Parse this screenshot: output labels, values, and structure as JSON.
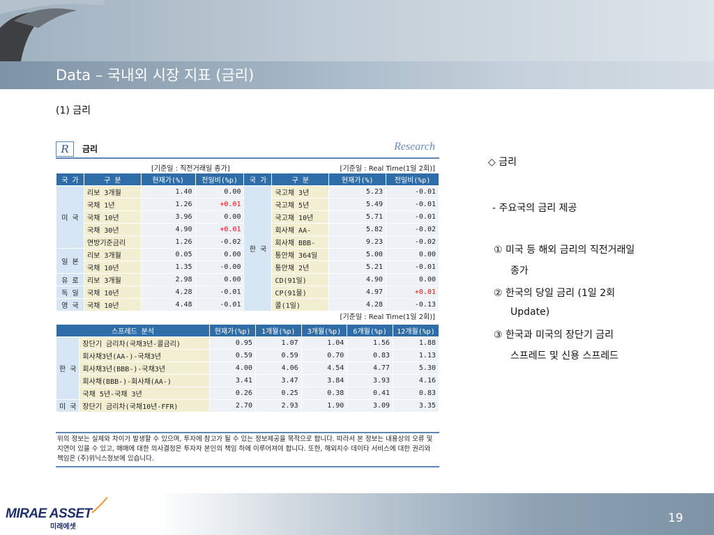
{
  "slide": {
    "title": "Data – 국내외 시장 지표 (금리)",
    "section": "(1) 금리",
    "page_number": "19"
  },
  "panel": {
    "logo_letter": "R",
    "title": "금리",
    "brand": "Research",
    "ref_left": "[기준일 : 직전거래일 종가]",
    "ref_right": "[기준일 : Real Time(1일 2회)]",
    "ref_spread": "[기준일 : Real Time(1일 2회)]",
    "headers_left": [
      "국 가",
      "구 분",
      "현재가(%)",
      "전일비(%p)"
    ],
    "headers_right": [
      "국 가",
      "구 분",
      "현재가(%)",
      "전일비(%p)"
    ],
    "left_groups": [
      {
        "country": "미 국",
        "rows": [
          {
            "name": "리보 3개월",
            "price": "1.40",
            "chg": "0.00",
            "up": false
          },
          {
            "name": "국채 1년",
            "price": "1.26",
            "chg": "+0.01",
            "up": true
          },
          {
            "name": "국채 10년",
            "price": "3.96",
            "chg": "0.00",
            "up": false
          },
          {
            "name": "국채 30년",
            "price": "4.90",
            "chg": "+0.01",
            "up": true
          },
          {
            "name": "연방기준금리",
            "price": "1.26",
            "chg": "-0.02",
            "up": false
          }
        ]
      },
      {
        "country": "일 본",
        "rows": [
          {
            "name": "리보 3개월",
            "price": "0.05",
            "chg": "0.00",
            "up": false
          },
          {
            "name": "국채 10년",
            "price": "1.35",
            "chg": "-0.00",
            "up": false
          }
        ]
      },
      {
        "country": "유 로",
        "rows": [
          {
            "name": "리보 3개월",
            "price": "2.98",
            "chg": "0.00",
            "up": false
          }
        ]
      },
      {
        "country": "독 일",
        "rows": [
          {
            "name": "국채 10년",
            "price": "4.28",
            "chg": "-0.01",
            "up": false
          }
        ]
      },
      {
        "country": "영 국",
        "rows": [
          {
            "name": "국채 10년",
            "price": "4.48",
            "chg": "-0.01",
            "up": false
          }
        ]
      }
    ],
    "right_country": "한 국",
    "right_rows": [
      {
        "name": "국고채 3년",
        "price": "5.23",
        "chg": "-0.01",
        "up": false
      },
      {
        "name": "국고채 5년",
        "price": "5.49",
        "chg": "-0.01",
        "up": false
      },
      {
        "name": "국고채 10년",
        "price": "5.71",
        "chg": "-0.01",
        "up": false
      },
      {
        "name": "회사채 AA-",
        "price": "5.82",
        "chg": "-0.02",
        "up": false
      },
      {
        "name": "회사채 BBB-",
        "price": "9.23",
        "chg": "-0.02",
        "up": false
      },
      {
        "name": "통안채 364일",
        "price": "5.00",
        "chg": "0.00",
        "up": false
      },
      {
        "name": "통안채 2년",
        "price": "5.21",
        "chg": "-0.01",
        "up": false
      },
      {
        "name": "CD(91일)",
        "price": "4.90",
        "chg": "0.00",
        "up": false
      },
      {
        "name": "CP(91물)",
        "price": "4.97",
        "chg": "+0.01",
        "up": true
      },
      {
        "name": "콜(1일)",
        "price": "4.28",
        "chg": "-0.13",
        "up": false
      }
    ],
    "spread_headers": [
      "스프레드 분석",
      "현재가(%p)",
      "1개월(%p)",
      "3개월(%p)",
      "6개월(%p)",
      "12개월(%p)"
    ],
    "spread_groups": [
      {
        "country": "한 국",
        "rows": [
          {
            "name": "장단기 금리차(국채3년-콜금리)",
            "v": [
              "0.95",
              "1.07",
              "1.04",
              "1.56",
              "1.88"
            ]
          },
          {
            "name": "회사채3년(AA-)-국채3년",
            "v": [
              "0.59",
              "0.59",
              "0.70",
              "0.83",
              "1.13"
            ]
          },
          {
            "name": "회사채3년(BBB-)-국채3년",
            "v": [
              "4.00",
              "4.06",
              "4.54",
              "4.77",
              "5.30"
            ]
          },
          {
            "name": "회사채(BBB-)-회사채(AA-)",
            "v": [
              "3.41",
              "3.47",
              "3.84",
              "3.93",
              "4.16"
            ]
          },
          {
            "name": "국채 5년-국채 3년",
            "v": [
              "0.26",
              "0.25",
              "0.38",
              "0.41",
              "0.83"
            ]
          }
        ]
      },
      {
        "country": "미 국",
        "rows": [
          {
            "name": "장단기 금리차(국채10년-FFR)",
            "v": [
              "2.70",
              "2.93",
              "1.90",
              "3.09",
              "3.35"
            ]
          }
        ]
      }
    ],
    "disclaimer": "위의 정보는 실제와 차이가 발생할 수 있으며, 투자에 참고가 될 수 있는 정보제공을 목적으로 합니다. 따라서 본 정보는 내용상의 오류 및 지연이 있을 수 있고, 매매에 대한 의사결정은 투자자 본인의 책임 하에 이루어져야 합니다. 또한, 해외지수 데이타 서비스에 대한 권리와 책임은 (주)위닉스정보에 있습니다."
  },
  "side_notes": {
    "heading": "◇ 금리",
    "bullet": "- 주요국의 금리 제공",
    "item1a": "① 미국 등 해외 금리의 직전거래일",
    "item1b": "종가",
    "item2a": "② 한국의 당일 금리 (1일 2회",
    "item2b": "Update)",
    "item3a": "③ 한국과 미국의 장단기 금리",
    "item3b": "스프레드 및 신용 스프레드"
  },
  "footer": {
    "logo_en": "MIRAE ASSET",
    "logo_kr": "미래에셋"
  },
  "colors": {
    "header_blue": "#2f6da8",
    "rule_blue": "#5c86b8",
    "up_red": "#e8140c",
    "title_bar": "#7d93a6"
  }
}
